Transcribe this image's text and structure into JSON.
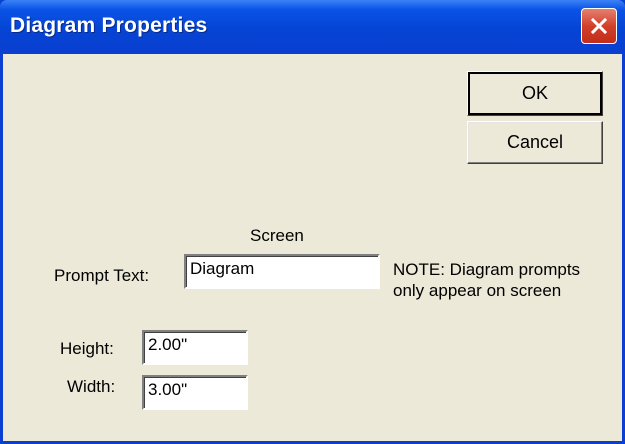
{
  "window": {
    "title": "Diagram Properties"
  },
  "buttons": {
    "ok_label": "OK",
    "cancel_label": "Cancel"
  },
  "section": {
    "heading": "Screen"
  },
  "prompt": {
    "label": "Prompt Text:",
    "value": "Diagram"
  },
  "note": {
    "line1": "NOTE: Diagram prompts",
    "line2": "only appear on screen"
  },
  "height": {
    "label": "Height:",
    "value": "2.00\""
  },
  "width": {
    "label": "Width:",
    "value": "3.00\""
  },
  "icons": {
    "close": "close-icon"
  },
  "colors": {
    "titlebar": "#0a3fd0",
    "close_button": "#d2402a",
    "face": "#ece9d8"
  }
}
